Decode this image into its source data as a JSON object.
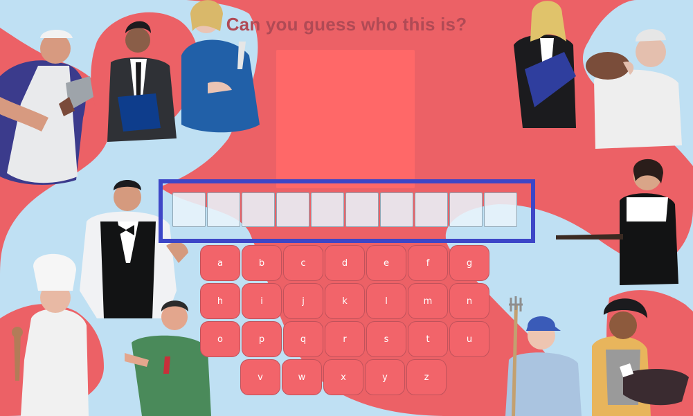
{
  "game": {
    "prompt": "Can you guess who this is?",
    "answer_slot_count": 10,
    "keyboard_rows": [
      [
        "a",
        "b",
        "c",
        "d",
        "e",
        "f",
        "g"
      ],
      [
        "h",
        "i",
        "j",
        "k",
        "l",
        "m",
        "n"
      ],
      [
        "o",
        "p",
        "q",
        "r",
        "s",
        "t",
        "u"
      ],
      [
        "v",
        "w",
        "x",
        "y",
        "z"
      ]
    ]
  },
  "colors": {
    "background": "#bfe0f3",
    "blob": "#ec6166",
    "portrait": "#ff6868",
    "answer_frame": "#3d46c7",
    "key_fill": "#f2646a",
    "title_text": "#b04a55"
  },
  "characters": [
    "butcher-illustration",
    "businessman-illustration",
    "mechanic-illustration",
    "businesswoman-illustration",
    "baker-illustration",
    "waiter-illustration",
    "chef-illustration",
    "gardener-illustration",
    "waitress-illustration",
    "farmer-illustration",
    "cook-illustration"
  ]
}
